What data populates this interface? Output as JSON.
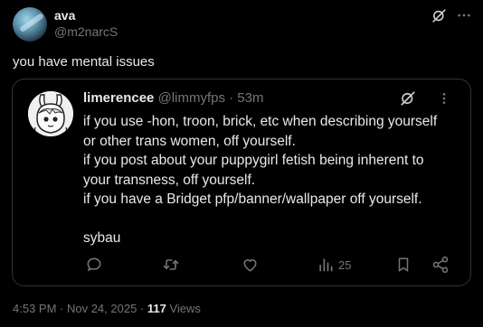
{
  "post": {
    "author": {
      "name": "ava",
      "handle": "@m2narcS"
    },
    "text": "you have mental issues",
    "icons": [
      "grok-icon",
      "more-icon"
    ]
  },
  "quote": {
    "author": {
      "name": "limerencee",
      "handle": "@limmyfps",
      "time": "· 53m"
    },
    "lines": [
      "if you use -hon, troon, brick, etc when describing yourself",
      "or other trans women, off yourself.",
      "if you post about your puppygirl fetish being inherent to",
      "your transness, off yourself.",
      "if you have a Bridget pfp/banner/wallpaper off yourself.",
      "",
      "sybau"
    ],
    "actions": {
      "views": "25"
    }
  },
  "meta": {
    "timestamp": "4:53 PM · Nov 24, 2025 · ",
    "views_count": "117",
    "views_label": " Views"
  },
  "colors": {
    "background": "#000000",
    "text": "#e7e9ea",
    "muted": "#71767b",
    "border": "#2f3336"
  }
}
